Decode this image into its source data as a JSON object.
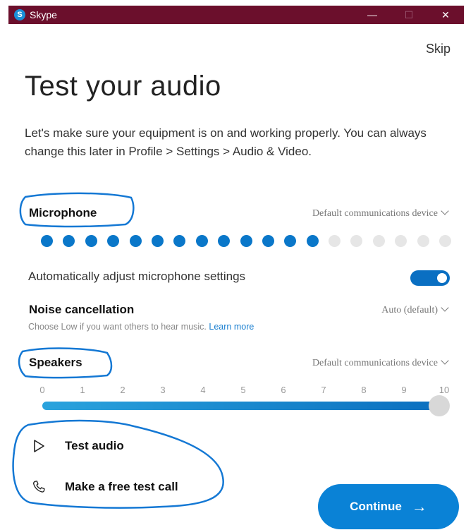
{
  "window": {
    "app_icon": "S",
    "title": "Skype",
    "minimize": "—",
    "maximize": "☐",
    "close": "✕"
  },
  "skip_label": "Skip",
  "heading": "Test your audio",
  "description": "Let's make sure your equipment is on and working properly. You can always change this later in Profile > Settings > Audio & Video.",
  "microphone": {
    "label": "Microphone",
    "device": "Default communications device",
    "level_active_dots": 13,
    "level_total_dots": 19
  },
  "auto_adjust": {
    "label": "Automatically adjust microphone settings",
    "enabled": true
  },
  "noise_cancellation": {
    "label": "Noise cancellation",
    "value": "Auto (default)",
    "hint": "Choose Low if you want others to hear music.",
    "learn_more": "Learn more"
  },
  "speakers": {
    "label": "Speakers",
    "device": "Default communications device",
    "ticks": [
      "0",
      "1",
      "2",
      "3",
      "4",
      "5",
      "6",
      "7",
      "8",
      "9",
      "10"
    ],
    "volume": 10
  },
  "actions": {
    "test_audio": "Test audio",
    "test_call": "Make a free test call"
  },
  "continue_label": "Continue",
  "colors": {
    "titlebar": "#6b0f2c",
    "accent": "#0a82d6",
    "annotation": "#1478d4"
  }
}
